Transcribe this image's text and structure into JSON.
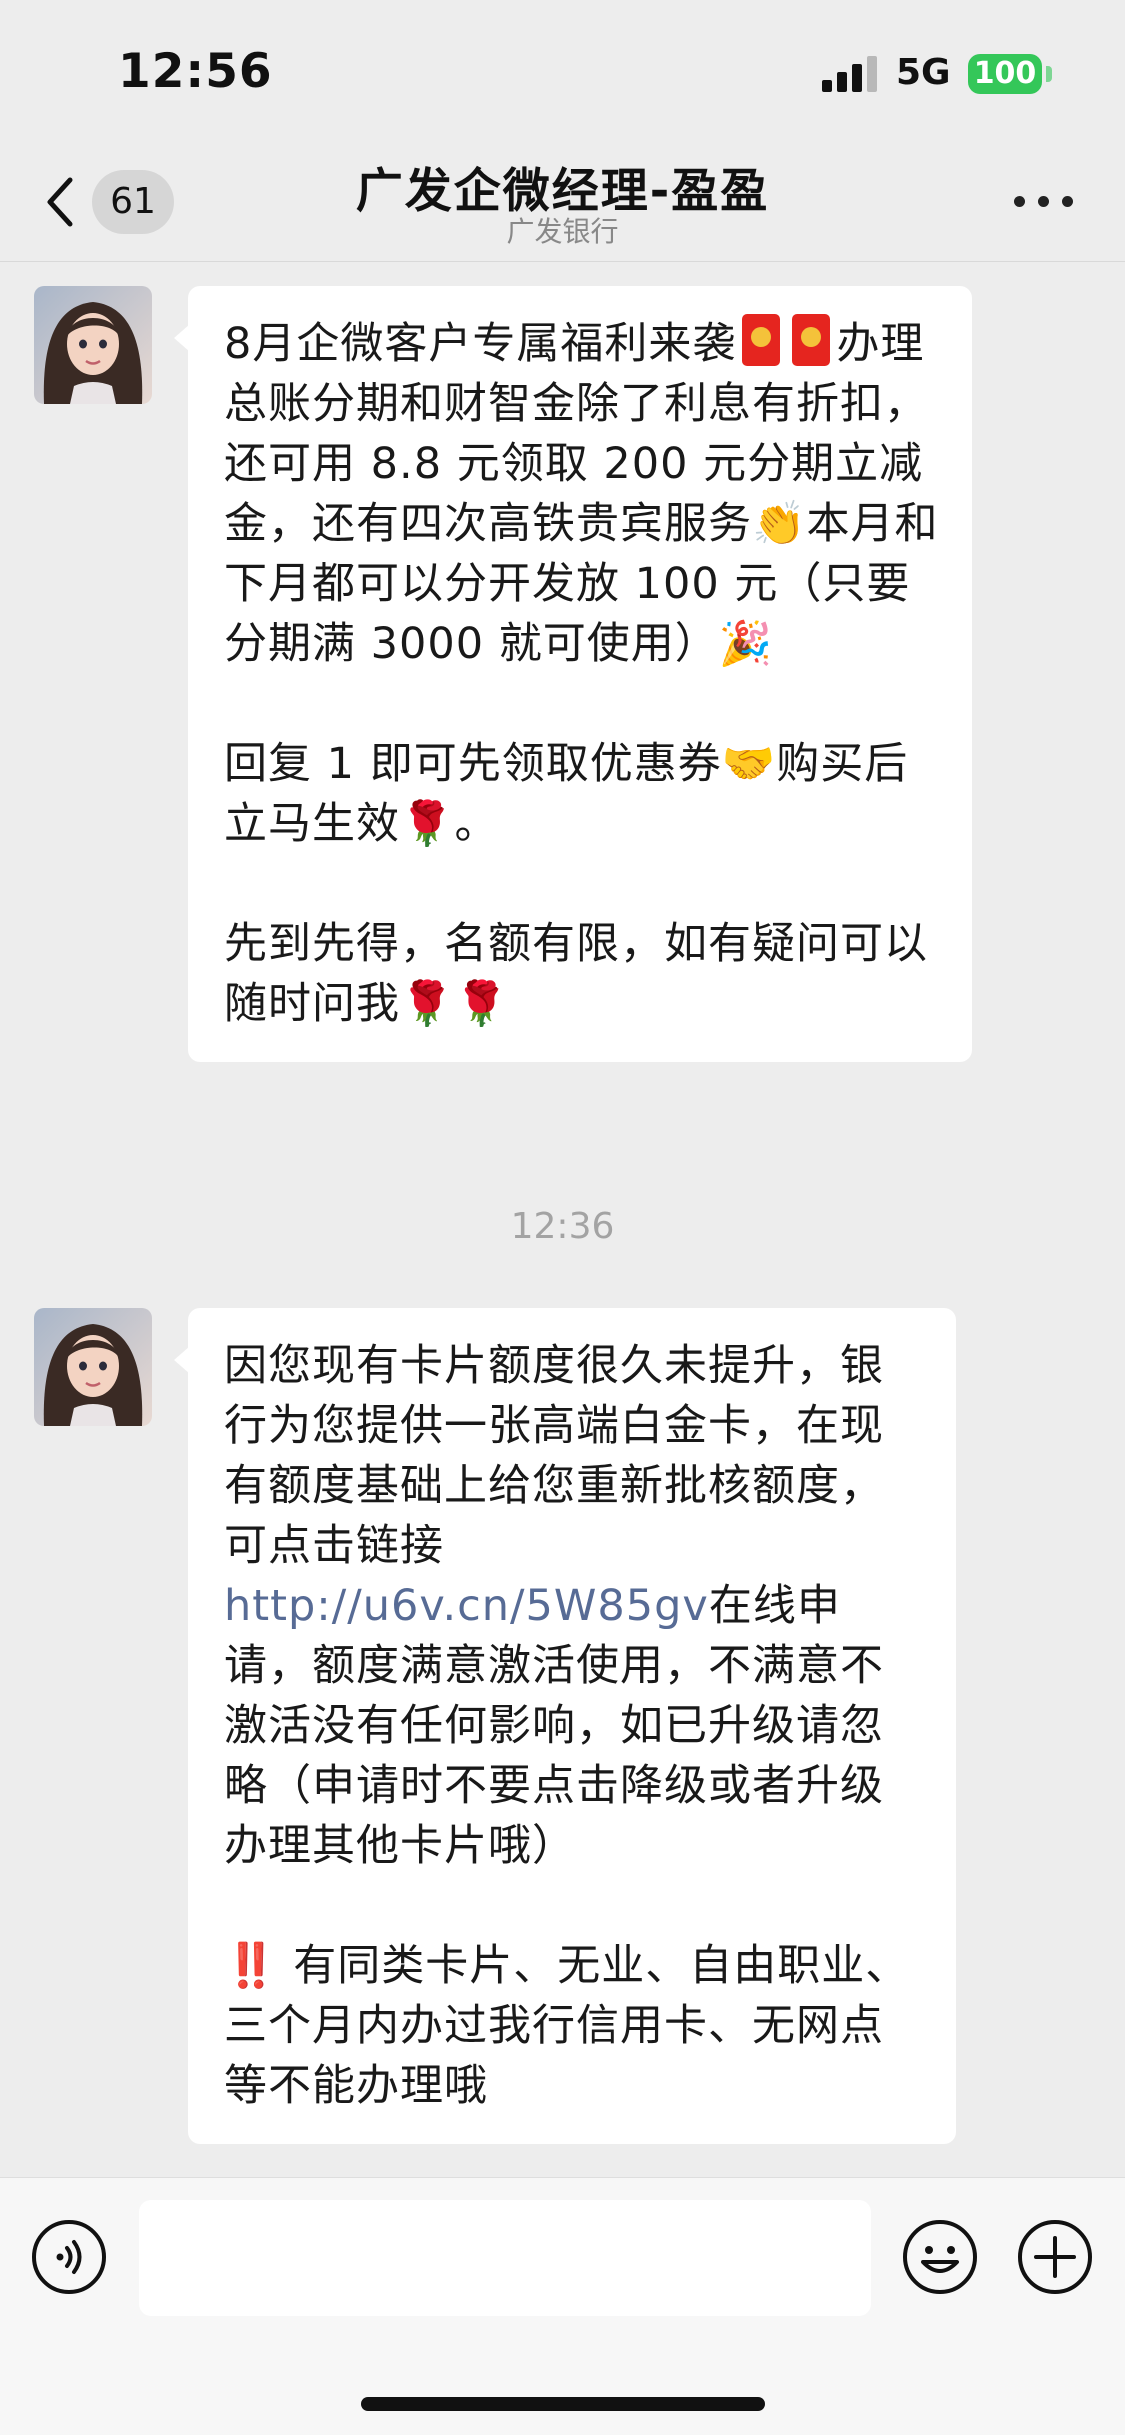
{
  "status_bar": {
    "time": "12:56",
    "network": "5G",
    "battery": "100",
    "battery_color": "#34c759"
  },
  "nav": {
    "back_icon": "chevron-left-icon",
    "unread_count": "61",
    "title": "广发企微经理-盈盈",
    "subtitle": "广发银行",
    "more_icon": "more-dots-icon"
  },
  "messages": [
    {
      "sender": "contact",
      "avatar_icon": "contact-avatar",
      "paragraphs": [
        {
          "line1": "8月企微客户专属福利来袭",
          "line2": "办理总账分期和财智金除了利息有折扣，还可用 8.8 元领取 200 元分期立减金，还有四次高铁贵宾服务",
          "emoji_clap": "👏",
          "line3": "本月和下月都可以分开发放 100 元（只要分期满 3000 就可使用）",
          "emoji_party": "🎉"
        },
        {
          "line1": "回复 1 即可先领取优惠券",
          "emoji_handshake": "🤝",
          "line2": "购买后立马生效",
          "emoji_rose": "🌹",
          "line3": "。"
        },
        {
          "line1": "先到先得，名额有限，如有疑问可以随时问我",
          "emoji_roses": "🌹🌹"
        }
      ]
    },
    {
      "timestamp": "12:36"
    },
    {
      "sender": "contact",
      "avatar_icon": "contact-avatar",
      "paragraphs": [
        {
          "before_link": "因您现有卡片额度很久未提升，银行为您提供一张高端白金卡，在现有额度基础上给您重新批核额度，可点击链接",
          "link": "http://u6v.cn/5W85gv",
          "after_link": "在线申请，额度满意激活使用，不满意不激活没有任何影响，如已升级请忽略（申请时不要点击降级或者升级办理其他卡片哦）"
        },
        {
          "emoji_alert": "‼️",
          "text": "有同类卡片、无业、自由职业、三个月内办过我行信用卡、无网点等不能办理哦"
        }
      ]
    }
  ],
  "input_bar": {
    "voice_icon": "voice-icon",
    "emoji_icon": "emoji-icon",
    "plus_icon": "plus-icon",
    "placeholder": ""
  },
  "colors": {
    "link": "#576b95",
    "background": "#ededed",
    "bubble": "#ffffff",
    "red_packet": "#e5251f"
  }
}
